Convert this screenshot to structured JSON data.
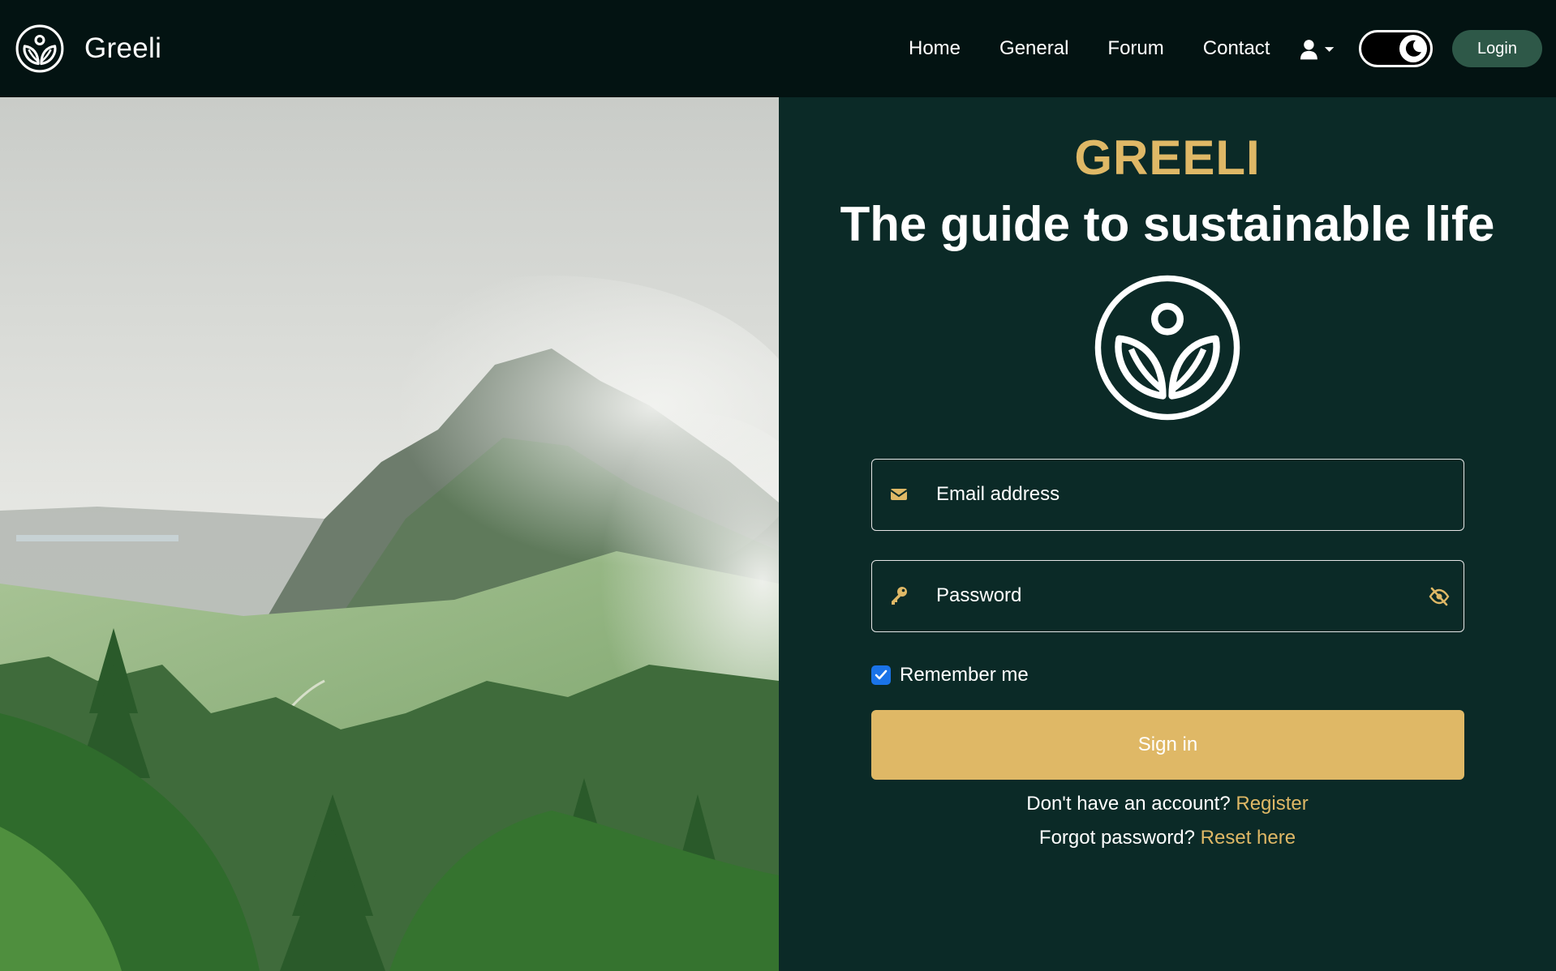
{
  "colors": {
    "nav_bg": "#031312",
    "panel_bg": "#0b2a27",
    "accent_gold": "#dfb866",
    "login_btn_bg": "#2e5848",
    "checkbox_blue": "#1a73e8"
  },
  "navbar": {
    "logo_icon": "greeli-leaf-logo-icon",
    "brand_name": "Greeli",
    "links": [
      "Home",
      "General",
      "Forum",
      "Contact"
    ],
    "user_icon": "user-icon",
    "dropdown_icon": "caret-down-icon",
    "theme_toggle_icon": "moon-icon",
    "login_label": "Login"
  },
  "hero": {
    "image": "misty-mountain-forest-photo"
  },
  "login_panel": {
    "brand": "GREELI",
    "tagline": "The guide to sustainable life",
    "logo_icon": "greeli-leaf-logo-icon",
    "email": {
      "icon": "envelope-icon",
      "placeholder": "Email address",
      "value": ""
    },
    "password": {
      "icon": "key-icon",
      "placeholder": "Password",
      "value": "",
      "toggle_icon": "eye-slash-icon"
    },
    "remember_me": {
      "label": "Remember me",
      "checked": true
    },
    "signin_label": "Sign in",
    "register_prompt": "Don't have an account? ",
    "register_link": "Register",
    "forgot_prompt": "Forgot password? ",
    "reset_link": "Reset here"
  }
}
